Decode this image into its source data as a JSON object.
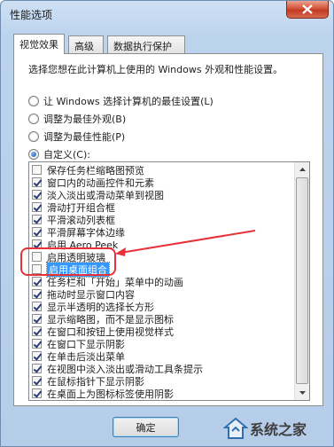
{
  "window": {
    "title": "性能选项"
  },
  "tabs": [
    {
      "label": "视觉效果",
      "active": true
    },
    {
      "label": "高级",
      "active": false
    },
    {
      "label": "数据执行保护",
      "active": false
    }
  ],
  "panel": {
    "intro": "选择您想在此计算机上使用的 Windows 外观和性能设置。",
    "options": [
      {
        "label": "让 Windows 选择计算机的最佳设置(L)",
        "checked": false
      },
      {
        "label": "调整为最佳外观(B)",
        "checked": false
      },
      {
        "label": "调整为最佳性能(P)",
        "checked": false
      },
      {
        "label": "自定义(C):",
        "checked": true
      }
    ]
  },
  "effects": [
    {
      "label": "保存任务栏缩略图预览",
      "checked": false
    },
    {
      "label": "窗口内的动画控件和元素",
      "checked": true
    },
    {
      "label": "淡入淡出或滑动菜单到视图",
      "checked": true
    },
    {
      "label": "滑动打开组合框",
      "checked": true
    },
    {
      "label": "平滑滚动列表框",
      "checked": true
    },
    {
      "label": "平滑屏幕字体边缘",
      "checked": true
    },
    {
      "label": "启用 Aero Peek",
      "checked": true
    },
    {
      "label": "启用透明玻璃",
      "checked": false
    },
    {
      "label": "启用桌面组合",
      "checked": false,
      "selected": true
    },
    {
      "label": "任务栏和「开始」菜单中的动画",
      "checked": true
    },
    {
      "label": "拖动时显示窗口内容",
      "checked": true
    },
    {
      "label": "显示半透明的选择长方形",
      "checked": true
    },
    {
      "label": "显示缩略图，而不是显示图标",
      "checked": true
    },
    {
      "label": "在窗口和按钮上使用视觉样式",
      "checked": true
    },
    {
      "label": "在窗口下显示阴影",
      "checked": true
    },
    {
      "label": "在单击后淡出菜单",
      "checked": true
    },
    {
      "label": "在视图中淡入淡出或滑动工具条提示",
      "checked": true
    },
    {
      "label": "在鼠标指针下显示阴影",
      "checked": true
    },
    {
      "label": "在桌面上为图标标签使用阴影",
      "checked": true
    }
  ],
  "buttons": {
    "ok": "确定"
  },
  "watermark": {
    "text": "系统之家"
  },
  "colors": {
    "annotation": "#e8323a",
    "selection": "#3399ff",
    "window_frame": "#b6cde9"
  }
}
